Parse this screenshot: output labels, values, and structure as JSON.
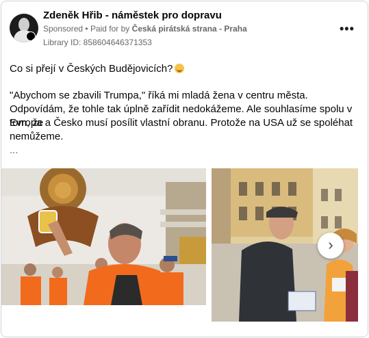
{
  "post": {
    "author": "Zdeněk Hřib - náměstek pro dopravu",
    "sponsored_label": "Sponsored",
    "separator": "•",
    "paid_for_by": "Paid for by",
    "payer": "Česká pirátská strana - Praha",
    "library_id": "Library ID: 858604646371353",
    "more_icon": "more-horizontal-icon",
    "text_lines": [
      "Co si přejí v Českých Budějovicích?",
      "\"Abychom se zbavili Trumpa,\" říká mi mladá žena v centru města.",
      "Odpovídám, že tohle tak úplně zařídit nedokážeme. Ale souhlasíme spolu v tom, že",
      "Evropa a Česko musí posílit vlastní obranu. Protože na USA už se spoléhat",
      "nemůžeme.",
      "..."
    ],
    "emoji_icon": "smiling-face-icon"
  },
  "carousel": {
    "next_icon": "chevron-right-icon",
    "next_label": "›"
  },
  "colors": {
    "text": "#050505",
    "muted": "#65676b",
    "vest": "#f26b1d",
    "border": "#cfd3d8"
  }
}
